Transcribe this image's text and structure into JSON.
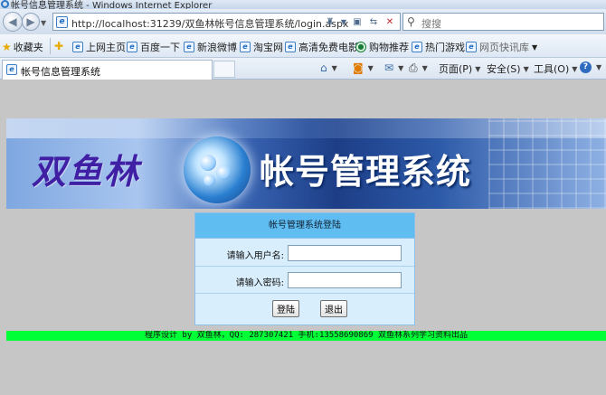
{
  "window": {
    "title": "帐号信息管理系统 - Windows Internet Explorer"
  },
  "address_bar": {
    "url": "http://localhost:31239/双鱼林帐号信息管理系统/login.aspx",
    "search_placeholder": "搜搜"
  },
  "favorites_bar": {
    "favorites_label": "收藏夹",
    "items": [
      {
        "label": "上网主页"
      },
      {
        "label": "百度一下"
      },
      {
        "label": "新浪微博"
      },
      {
        "label": "淘宝网"
      },
      {
        "label": "高清免费电影"
      },
      {
        "label": "购物推荐"
      },
      {
        "label": "热门游戏"
      },
      {
        "label": "网页快讯库"
      }
    ]
  },
  "tab": {
    "label": "帐号信息管理系统"
  },
  "command_bar": {
    "page_label": "页面(P)",
    "safety_label": "安全(S)",
    "tools_label": "工具(O)"
  },
  "banner": {
    "brand_text": "双鱼林",
    "system_text": "帐号管理系统"
  },
  "login": {
    "title": "帐号管理系统登陆",
    "username_label": "请输入用户名:",
    "username_value": "",
    "password_label": "请输入密码:",
    "password_value": "",
    "login_button": "登陆",
    "exit_button": "退出"
  },
  "footer": {
    "text": "程序设计 by 双鱼林，QQ: 287307421 手机:13558690869 双鱼林系列学习资料出品"
  },
  "colors": {
    "footer_bg": "#00ff37",
    "login_header": "#5fbdf2",
    "login_body": "#d8eefc",
    "page_bg": "#c6c6c6"
  }
}
